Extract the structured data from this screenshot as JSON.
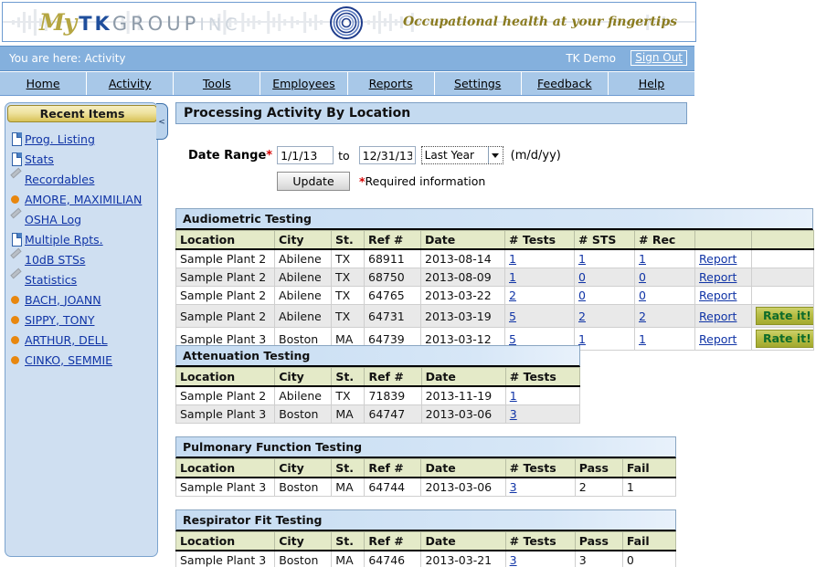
{
  "header": {
    "brand": {
      "my": "My",
      "tk": "TK",
      "group": "GROUP",
      "inc": "INC"
    },
    "tagline": "Occupational health at your fingertips"
  },
  "breadcrumb": {
    "text": "You are here: Activity",
    "user": "TK Demo",
    "sign_out": "Sign Out"
  },
  "nav": {
    "items": [
      "Home",
      "Activity",
      "Tools",
      "Employees",
      "Reports",
      "Settings",
      "Feedback",
      "Help"
    ]
  },
  "sidebar": {
    "title": "Recent Items",
    "collapse_glyph": "<",
    "items": [
      {
        "label": "Prog. Listing",
        "icon": "page-icon"
      },
      {
        "label": "Stats",
        "icon": "page-icon"
      },
      {
        "label": "Recordables",
        "icon": "pencil-icon"
      },
      {
        "label": "AMORE, MAXIMILIAN",
        "icon": "orange-dot-icon"
      },
      {
        "label": "OSHA Log",
        "icon": "pencil-icon"
      },
      {
        "label": "Multiple Rpts.",
        "icon": "page-icon"
      },
      {
        "label": "10dB STSs",
        "icon": "pencil-icon"
      },
      {
        "label": "Statistics",
        "icon": "pencil-icon"
      },
      {
        "label": "BACH, JOANN",
        "icon": "orange-dot-icon"
      },
      {
        "label": "SIPPY, TONY",
        "icon": "orange-dot-icon"
      },
      {
        "label": "ARTHUR, DELL",
        "icon": "orange-dot-icon"
      },
      {
        "label": "CINKO, SEMMIE",
        "icon": "orange-dot-icon"
      }
    ]
  },
  "main": {
    "title": "Processing Activity By Location",
    "form": {
      "label": "Date Range",
      "required_mark": "*",
      "from_value": "1/1/13",
      "to_label": "to",
      "to_value": "12/31/13",
      "preset_selected": "Last Year",
      "format_hint": "(m/d/yy)",
      "update_label": "Update",
      "required_note": "Required information"
    },
    "tables": [
      {
        "caption": "Audiometric Testing",
        "columns": [
          "Location",
          "City",
          "St.",
          "Ref #",
          "Date",
          "# Tests",
          "# STS",
          "# Rec",
          "",
          ""
        ],
        "col_widths": [
          "108px",
          "62px",
          "36px",
          "62px",
          "92px",
          "76px",
          "66px",
          "66px",
          "62px",
          "68px"
        ],
        "rows": [
          {
            "cells": [
              "Sample Plant 2",
              "Abilene",
              "TX",
              "68911",
              "2013-08-14",
              "1",
              "1",
              "1",
              "Report",
              ""
            ],
            "links": [
              false,
              false,
              false,
              false,
              false,
              true,
              true,
              true,
              true,
              false
            ],
            "rate": false
          },
          {
            "cells": [
              "Sample Plant 2",
              "Abilene",
              "TX",
              "68750",
              "2013-08-09",
              "1",
              "0",
              "0",
              "Report",
              ""
            ],
            "links": [
              false,
              false,
              false,
              false,
              false,
              true,
              true,
              true,
              true,
              false
            ],
            "rate": false
          },
          {
            "cells": [
              "Sample Plant 2",
              "Abilene",
              "TX",
              "64765",
              "2013-03-22",
              "2",
              "0",
              "0",
              "Report",
              ""
            ],
            "links": [
              false,
              false,
              false,
              false,
              false,
              true,
              true,
              true,
              true,
              false
            ],
            "rate": false
          },
          {
            "cells": [
              "Sample Plant 2",
              "Abilene",
              "TX",
              "64731",
              "2013-03-19",
              "5",
              "2",
              "2",
              "Report",
              "Rate it!"
            ],
            "links": [
              false,
              false,
              false,
              false,
              false,
              true,
              true,
              true,
              true,
              false
            ],
            "rate": true
          },
          {
            "cells": [
              "Sample Plant 3",
              "Boston",
              "MA",
              "64739",
              "2013-03-12",
              "5",
              "1",
              "1",
              "Report",
              "Rate it!"
            ],
            "links": [
              false,
              false,
              false,
              false,
              false,
              true,
              true,
              true,
              true,
              false
            ],
            "rate": true
          }
        ]
      },
      {
        "caption": "Attenuation Testing",
        "columns": [
          "Location",
          "City",
          "St.",
          "Ref #",
          "Date",
          "# Tests"
        ],
        "col_widths": [
          "108px",
          "62px",
          "36px",
          "62px",
          "92px",
          "81px"
        ],
        "rows": [
          {
            "cells": [
              "Sample Plant 2",
              "Abilene",
              "TX",
              "71839",
              "2013-11-19",
              "1"
            ],
            "links": [
              false,
              false,
              false,
              false,
              false,
              true
            ],
            "rate": false
          },
          {
            "cells": [
              "Sample Plant 3",
              "Boston",
              "MA",
              "64747",
              "2013-03-06",
              "3"
            ],
            "links": [
              false,
              false,
              false,
              false,
              false,
              true
            ],
            "rate": false
          }
        ]
      },
      {
        "caption": "Pulmonary Function Testing",
        "columns": [
          "Location",
          "City",
          "St.",
          "Ref #",
          "Date",
          "# Tests",
          "Pass",
          "Fail"
        ],
        "col_widths": [
          "108px",
          "62px",
          "36px",
          "62px",
          "92px",
          "76px",
          "52px",
          "58px"
        ],
        "rows": [
          {
            "cells": [
              "Sample Plant 3",
              "Boston",
              "MA",
              "64744",
              "2013-03-06",
              "3",
              "2",
              "1"
            ],
            "links": [
              false,
              false,
              false,
              false,
              false,
              true,
              false,
              false
            ],
            "rate": false
          }
        ]
      },
      {
        "caption": "Respirator Fit Testing",
        "columns": [
          "Location",
          "City",
          "St.",
          "Ref #",
          "Date",
          "# Tests",
          "Pass",
          "Fail"
        ],
        "col_widths": [
          "108px",
          "62px",
          "36px",
          "62px",
          "92px",
          "76px",
          "52px",
          "58px"
        ],
        "rows": [
          {
            "cells": [
              "Sample Plant 3",
              "Boston",
              "MA",
              "64746",
              "2013-03-21",
              "3",
              "3",
              "0"
            ],
            "links": [
              false,
              false,
              false,
              false,
              false,
              true,
              false,
              false
            ],
            "rate": false
          }
        ]
      }
    ]
  }
}
